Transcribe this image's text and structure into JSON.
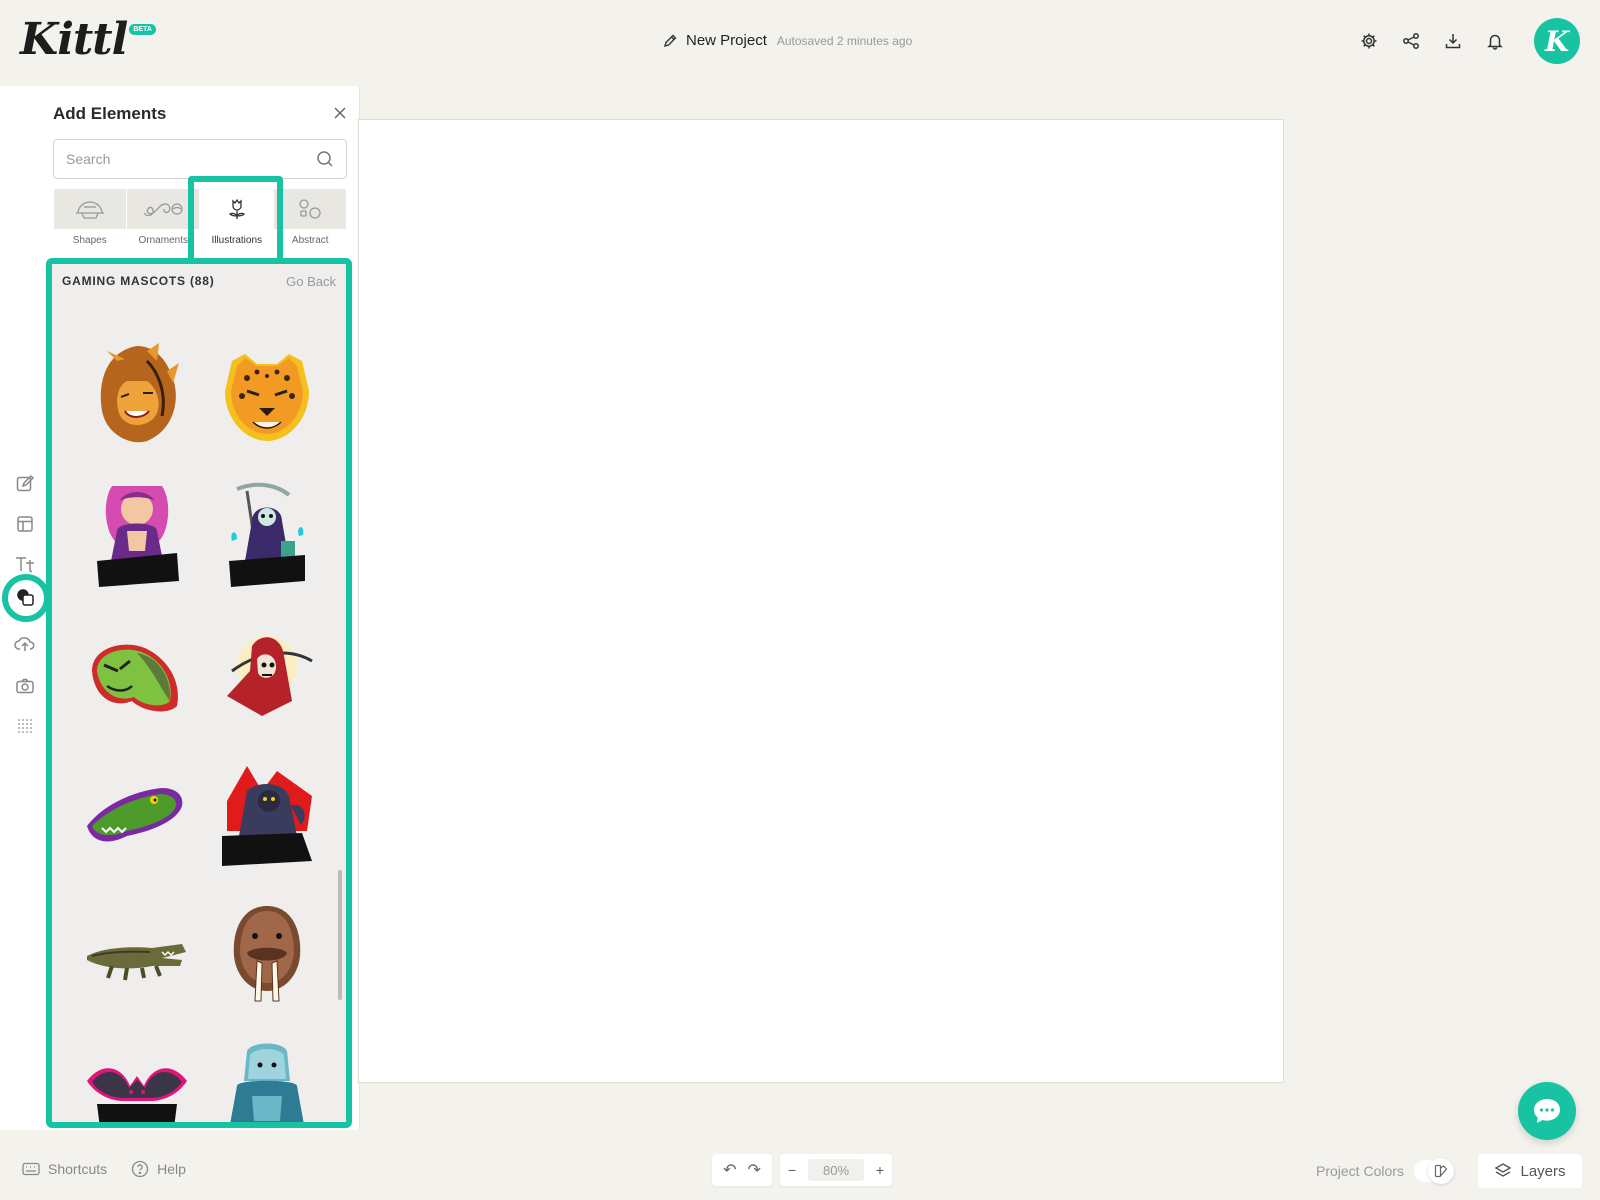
{
  "app": {
    "logo": "Kittl",
    "beta_badge": "BETA"
  },
  "header": {
    "project_name": "New Project",
    "autosave_status": "Autosaved 2 minutes ago",
    "icons": [
      "gear-icon",
      "share-icon",
      "download-icon",
      "bell-icon"
    ],
    "avatar_letter": "K"
  },
  "rail": {
    "items": [
      "edit-icon",
      "templates-icon",
      "text-icon",
      "elements-icon",
      "upload-icon",
      "camera-icon",
      "grid-dots-icon"
    ],
    "active": "elements-icon"
  },
  "panel": {
    "title": "Add Elements",
    "search_placeholder": "Search",
    "categories": [
      {
        "label": "Shapes",
        "icon": "shapes-icon"
      },
      {
        "label": "Ornaments",
        "icon": "ornament-icon"
      },
      {
        "label": "Illustrations",
        "icon": "flower-icon",
        "active": true
      },
      {
        "label": "Abstract",
        "icon": "abstract-icon"
      }
    ],
    "results_title": "GAMING MASCOTS (88)",
    "go_back": "Go Back",
    "mascots": [
      "lion",
      "leopard",
      "girl-gamer",
      "reaper-lantern",
      "turtle",
      "hooded-reaper",
      "crocodile-head",
      "gorilla-warrior",
      "crocodile",
      "walrus",
      "bat",
      "zombie"
    ]
  },
  "footer": {
    "shortcuts": "Shortcuts",
    "help": "Help",
    "zoom": "80%",
    "project_colors": "Project Colors",
    "layers": "Layers"
  },
  "colors": {
    "accent": "#17c3a2",
    "background": "#f4f2ed"
  }
}
